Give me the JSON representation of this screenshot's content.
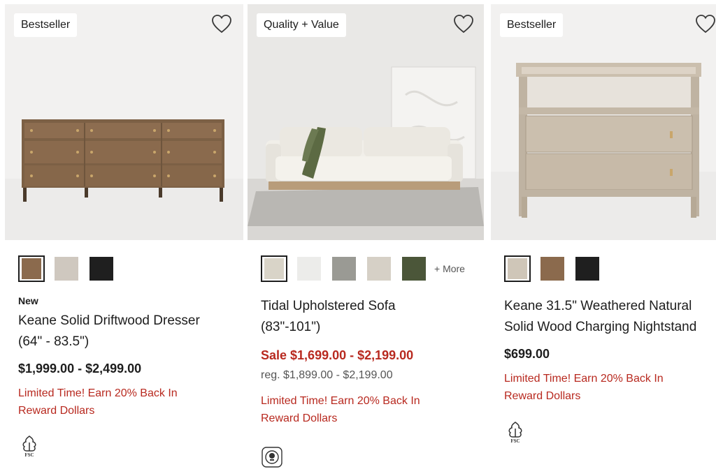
{
  "products": [
    {
      "badge": "Bestseller",
      "new_label": "New",
      "title_line1": "Keane Solid Driftwood Dresser",
      "title_line2": "(64\" - 83.5\")",
      "price": "$1,999.00 - $2,499.00",
      "promo_line1": "Limited Time! Earn 20% Back In",
      "promo_line2": "Reward Dollars",
      "cert_label": "FSC",
      "swatches": [
        {
          "color": "#8b6a4d",
          "selected": true
        },
        {
          "color": "#cfc8bf",
          "selected": false
        },
        {
          "color": "#1f1f1f",
          "selected": false
        }
      ]
    },
    {
      "badge": "Quality + Value",
      "title_line1": "Tidal Upholstered Sofa",
      "title_line2": "(83\"-101\")",
      "sale_price": "Sale $1,699.00 - $2,199.00",
      "reg_price": "reg. $1,899.00 - $2,199.00",
      "promo_line1": "Limited Time! Earn 20% Back In",
      "promo_line2": "Reward Dollars",
      "more_label": "+ More",
      "swatches": [
        {
          "color": "#d9d4c8",
          "selected": true
        },
        {
          "color": "#ececea",
          "selected": false
        },
        {
          "color": "#9a9a94",
          "selected": false
        },
        {
          "color": "#d6d0c6",
          "selected": false
        },
        {
          "color": "#4b5639",
          "selected": false
        }
      ]
    },
    {
      "badge": "Bestseller",
      "title_line1": "Keane 31.5\" Weathered Natural",
      "title_line2": "Solid Wood Charging Nightstand",
      "price": "$699.00",
      "promo_line1": "Limited Time! Earn 20% Back In",
      "promo_line2": "Reward Dollars",
      "cert_label": "FSC",
      "swatches": [
        {
          "color": "#cfc6b8",
          "selected": true
        },
        {
          "color": "#8b6a4d",
          "selected": false
        },
        {
          "color": "#1f1f1f",
          "selected": false
        }
      ]
    }
  ],
  "colors": {
    "sale_red": "#b8291f",
    "text": "#1d1d1d"
  }
}
